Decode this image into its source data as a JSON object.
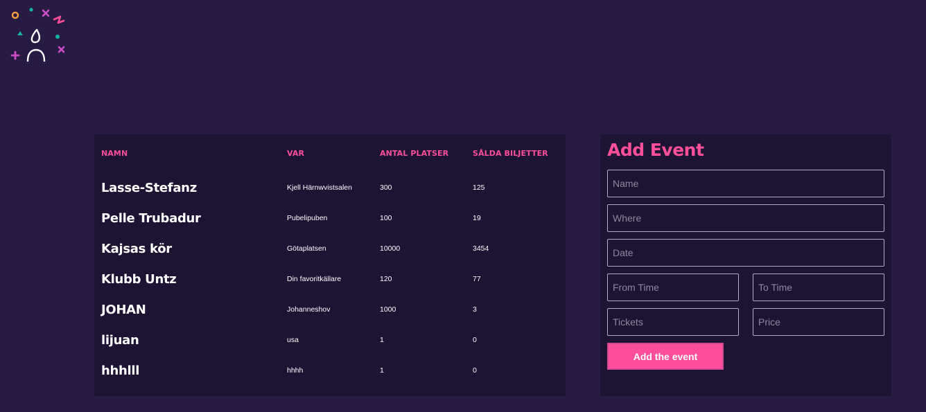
{
  "table": {
    "headers": {
      "name": "NAMN",
      "where": "VAR",
      "seats": "ANTAL PLATSER",
      "sold": "SÅLDA BILJETTER"
    },
    "rows": [
      {
        "name": "Lasse-Stefanz",
        "where": "Kjell Härnwvistsalen",
        "seats": "300",
        "sold": "125"
      },
      {
        "name": "Pelle Trubadur",
        "where": "Pubelipuben",
        "seats": "100",
        "sold": "19"
      },
      {
        "name": "Kajsas kör",
        "where": "Götaplatsen",
        "seats": "10000",
        "sold": "3454"
      },
      {
        "name": "Klubb Untz",
        "where": "Din favoritkällare",
        "seats": "120",
        "sold": "77"
      },
      {
        "name": "JOHAN",
        "where": "Johanneshov",
        "seats": "1000",
        "sold": "3"
      },
      {
        "name": "lijuan",
        "where": "usa",
        "seats": "1",
        "sold": "0"
      },
      {
        "name": "hhhlll",
        "where": "hhhh",
        "seats": "1",
        "sold": "0"
      }
    ]
  },
  "form": {
    "title": "Add Event",
    "name_placeholder": "Name",
    "where_placeholder": "Where",
    "date_placeholder": "Date",
    "from_placeholder": "From Time",
    "to_placeholder": "To Time",
    "tickets_placeholder": "Tickets",
    "price_placeholder": "Price",
    "submit_label": "Add the event"
  },
  "colors": {
    "background": "#271b44",
    "panel": "#1d1433",
    "accent": "#ff4f9a"
  },
  "icons": {
    "logo": "party-logo-icon"
  }
}
